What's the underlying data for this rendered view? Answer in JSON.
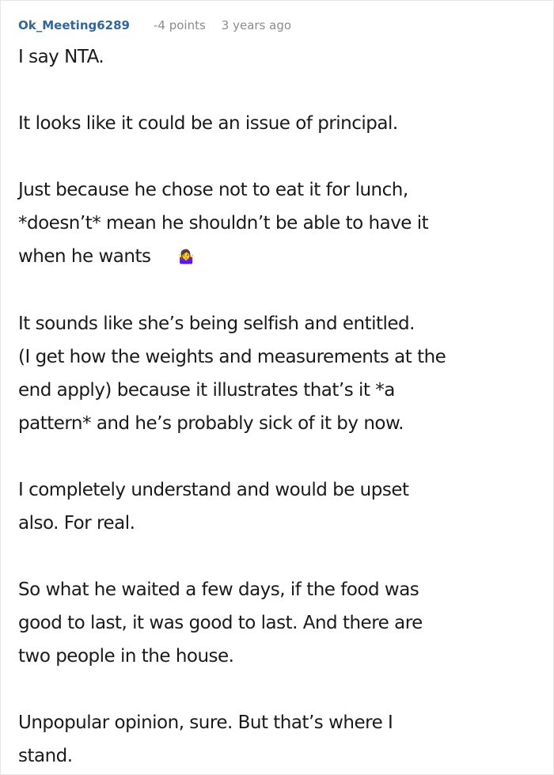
{
  "comment": {
    "author": "Ok_Meeting6289",
    "points": "-4 points",
    "timestamp": "3 years ago",
    "paragraphs": [
      {
        "lines": [
          "I say NTA."
        ]
      },
      {
        "lines": [
          "It looks like it could be an issue of principal."
        ]
      },
      {
        "lines": [
          "Just because he chose not to eat it for lunch,",
          "*doesn’t* mean he shouldn’t be able to have it",
          "when he wants"
        ],
        "emoji": "🤷‍♀️"
      },
      {
        "lines": [
          "It sounds like she’s being selfish and entitled.",
          "(I get how the weights and measurements at the",
          "end apply) because it illustrates that’s it *a",
          "pattern* and he’s probably sick of it by now."
        ]
      },
      {
        "lines": [
          "I completely understand and would be upset",
          "also. For real."
        ]
      },
      {
        "lines": [
          "So what he waited a few days, if the food was",
          "good to last, it was good to last. And there are",
          "two people in the house."
        ]
      },
      {
        "lines": [
          "Unpopular opinion, sure. But that’s where I",
          "stand."
        ]
      }
    ]
  }
}
